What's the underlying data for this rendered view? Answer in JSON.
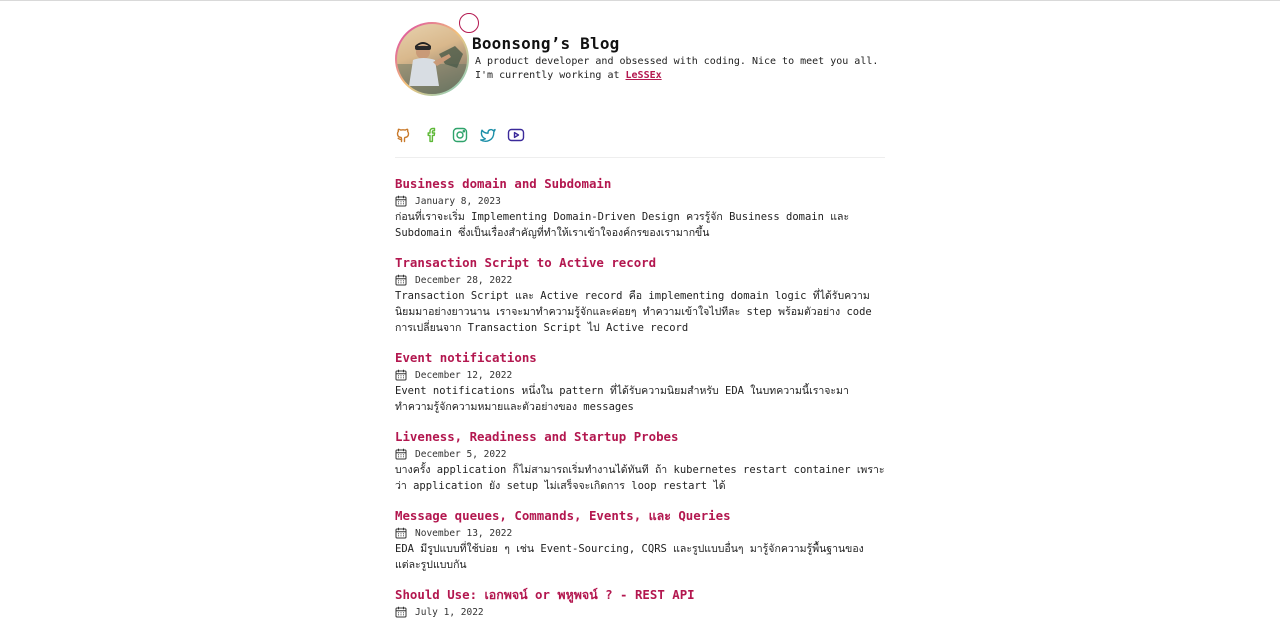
{
  "profile": {
    "name": "Boonsong’s Blog",
    "bio_line1": "A product developer and obsessed with coding. Nice to meet you all.",
    "bio_line2_prefix": "I'm currently working at ",
    "company": "LeSSEx"
  },
  "socials": [
    {
      "icon": "github-icon",
      "color": "#c97a2b"
    },
    {
      "icon": "facebook-icon",
      "color": "#5db836"
    },
    {
      "icon": "instagram-icon",
      "color": "#2fa36b"
    },
    {
      "icon": "twitter-icon",
      "color": "#1c8fa8"
    },
    {
      "icon": "youtube-icon",
      "color": "#3b2a9a"
    }
  ],
  "posts": [
    {
      "title": "Business domain and Subdomain",
      "date": "January 8, 2023",
      "description": "ก่อนที่เราจะเริ่ม Implementing Domain-Driven Design ควรรู้จัก Business domain และ Subdomain ซึ่งเป็นเรื่องสำคัญที่ทำให้เราเข้าใจองค์กรของเรามากขึ้น"
    },
    {
      "title": "Transaction Script to Active record",
      "date": "December 28, 2022",
      "description": "Transaction Script และ Active record คือ implementing domain logic ที่ได้รับความนิยมมาอย่างยาวนาน เราจะมาทำความรู้จักและค่อยๆ ทำความเข้าใจไปทีละ step พร้อมตัวอย่าง code การเปลี่ยนจาก Transaction Script ไป Active record"
    },
    {
      "title": "Event notifications",
      "date": "December 12, 2022",
      "description": "Event notifications หนึ่งใน pattern ที่ได้รับความนิยมสำหรับ EDA ในบทความนี้เราจะมาทำความรู้จักความหมายและตัวอย่างของ messages"
    },
    {
      "title": "Liveness, Readiness and Startup Probes",
      "date": "December 5, 2022",
      "description": "บางครั้ง application ก็ไม่สามารถเริ่มทำงานได้ทันที ถ้า kubernetes restart container เพราะว่า application ยัง setup ไม่เสร็จจะเกิดการ loop restart ได้"
    },
    {
      "title": "Message queues, Commands, Events, และ Queries",
      "date": "November 13, 2022",
      "description": "EDA มีรูปแบบที่ใช้บ่อย ๆ เช่น Event-Sourcing, CQRS และรูปแบบอื่นๆ มารู้จักความรู้พื้นฐานของแต่ละรูปแบบกัน"
    },
    {
      "title": "Should Use: เอกพจน์ or พหูพจน์ ? - REST API",
      "date": "July 1, 2022",
      "description": ""
    }
  ],
  "colors": {
    "accent": "#b3174f",
    "text": "#1f1f1f"
  }
}
